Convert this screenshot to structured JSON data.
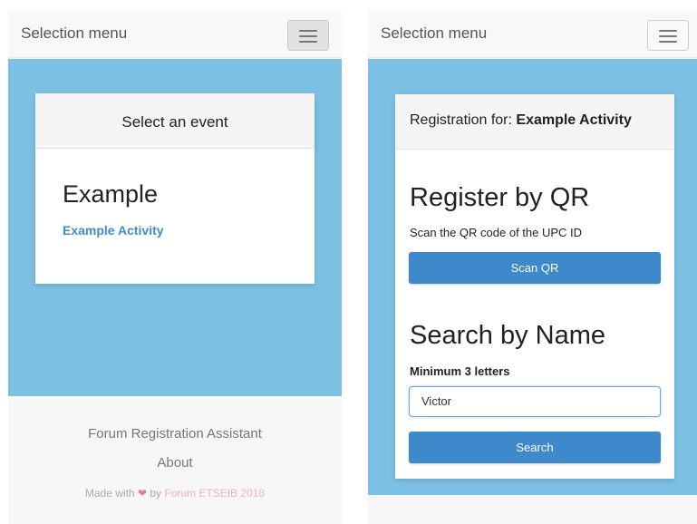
{
  "left": {
    "navbar": {
      "brand": "Selection menu"
    },
    "card": {
      "header": "Select an event",
      "event_title": "Example",
      "activity_link": "Example Activity"
    },
    "footer": {
      "title": "Forum Registration Assistant",
      "about": "About",
      "made_prefix": "Made with",
      "heart": "❤",
      "by": "by",
      "forum": "Forum ETSEIB 2018"
    }
  },
  "right": {
    "navbar": {
      "brand": "Selection menu"
    },
    "card": {
      "header_prefix": "Registration for: ",
      "header_activity": "Example Activity",
      "qr_title": "Register by QR",
      "qr_desc": "Scan the QR code of the UPC ID",
      "scan_button": "Scan QR",
      "name_title": "Search by Name",
      "min_label": "Minimum 3 letters",
      "search_value": "Victor",
      "search_button": "Search"
    }
  },
  "colors": {
    "blue_background": "#7cc1e4",
    "button_blue": "#3d89cc",
    "link_blue": "#3d8bd1",
    "heart_pink": "#e07a9e"
  }
}
